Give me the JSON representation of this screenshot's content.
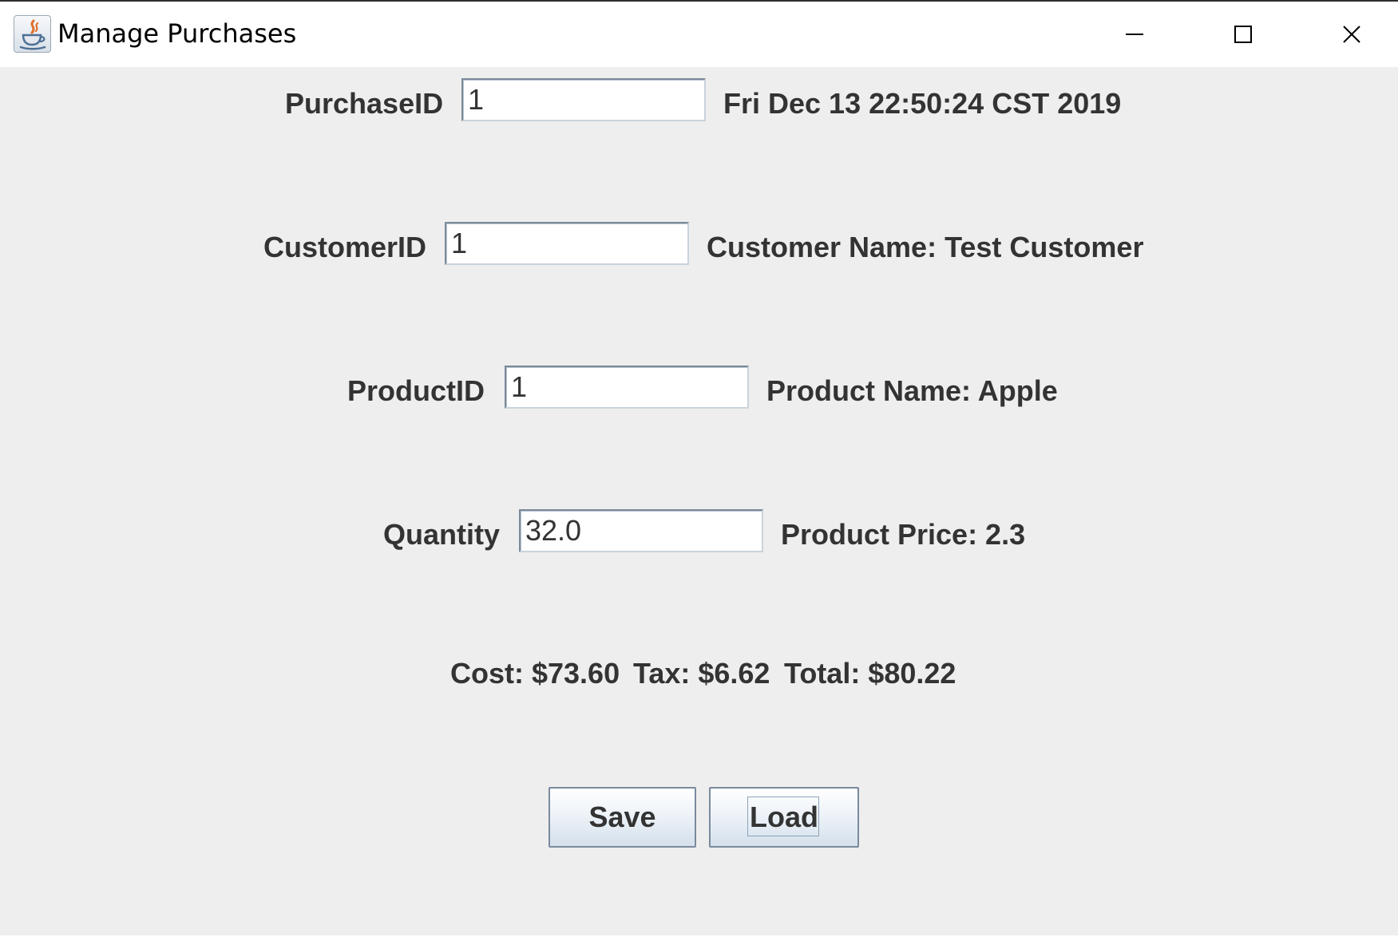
{
  "window": {
    "title": "Manage Purchases"
  },
  "form": {
    "purchase": {
      "label": "PurchaseID",
      "value": "1",
      "info": "Fri Dec 13 22:50:24 CST 2019"
    },
    "customer": {
      "label": "CustomerID",
      "value": "1",
      "info": "Customer Name: Test Customer"
    },
    "product": {
      "label": "ProductID",
      "value": "1",
      "info": "Product Name: Apple"
    },
    "quantity": {
      "label": "Quantity",
      "value": "32.0",
      "info": "Product Price: 2.3"
    }
  },
  "summary": {
    "cost": "Cost: $73.60",
    "tax": "Tax: $6.62",
    "total": "Total: $80.22"
  },
  "buttons": {
    "save": "Save",
    "load": "Load"
  },
  "icons": {
    "app": "java-coffee-cup-icon",
    "minimize": "minimize-icon",
    "maximize": "maximize-icon",
    "close": "close-icon"
  }
}
